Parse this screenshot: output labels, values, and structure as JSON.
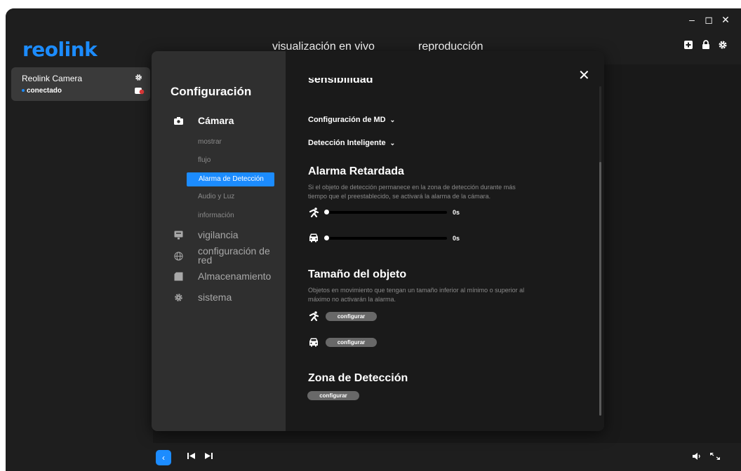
{
  "app": {
    "brand": "reolink",
    "nav": {
      "live": "visualización en vivo",
      "playback": "reproducción"
    },
    "window_controls": {
      "minimize": "–",
      "maximize": "◻",
      "close": "✕"
    },
    "accent": "#1c8cff"
  },
  "sidebar": {
    "camera": {
      "name": "Reolink Camera",
      "status": "conectado"
    }
  },
  "config": {
    "title": "Configuración",
    "menu": [
      {
        "label": "Cámara",
        "icon": "camera-icon"
      },
      {
        "label": "vigilancia",
        "icon": "monitor-icon"
      },
      {
        "label": "configuración de red",
        "icon": "globe-icon"
      },
      {
        "label": "Almacenamiento",
        "icon": "storage-icon"
      },
      {
        "label": "sistema",
        "icon": "gear-icon"
      }
    ],
    "submenu": [
      "mostrar",
      "flujo",
      "Alarma de Detección",
      "Audio y Luz",
      "información"
    ],
    "active_submenu": "Alarma de Detección"
  },
  "content": {
    "cut_heading": "sensibilidad",
    "md_config": "Configuración de MD",
    "smart_detect": "Detección Inteligente",
    "delay_alarm": {
      "title": "Alarma Retardada",
      "desc": "Si el objeto de detección permanece en la zona de detección durante más tiempo que el preestablecido, se activará la alarma de la cámara.",
      "person_value": "0s",
      "vehicle_value": "0s"
    },
    "object_size": {
      "title": "Tamaño del objeto",
      "desc": "Objetos en movimiento que tengan un tamaño inferior al mínimo o superior al máximo no activarán la alarma.",
      "person_btn": "configurar",
      "vehicle_btn": "configurar"
    },
    "zone": {
      "title": "Zona de Detección",
      "btn": "configurar"
    }
  },
  "bottom": {
    "toggle": "‹"
  }
}
